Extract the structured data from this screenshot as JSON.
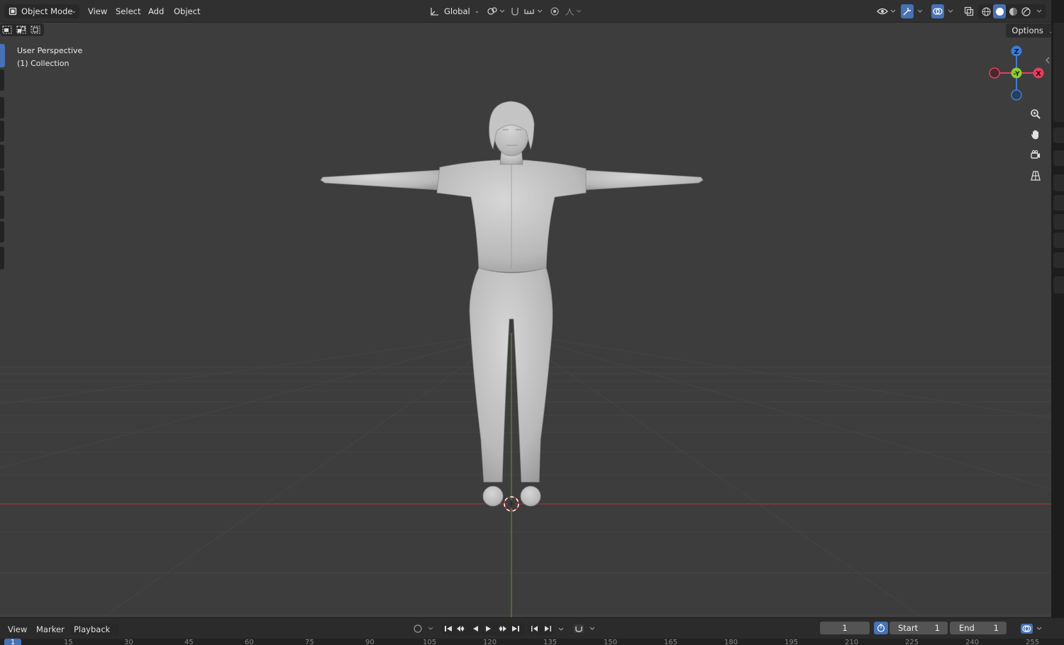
{
  "header": {
    "mode_label": "Object Mode",
    "menus": [
      "View",
      "Select",
      "Add",
      "Object"
    ],
    "orientation_label": "Global",
    "options_label": "Options"
  },
  "overlay": {
    "line1": "User Perspective",
    "line2": "(1) Collection"
  },
  "gizmo": {
    "z_label": "Z",
    "y_label": "-Y",
    "x_label": "X"
  },
  "timeline": {
    "menus": [
      "View",
      "Marker"
    ],
    "playback_label": "Playback",
    "current_frame": "1",
    "start_label": "Start",
    "start_value": "1",
    "end_label": "End",
    "end_value": "1",
    "ruler_marker": "1",
    "ruler_ticks": [
      "15",
      "30",
      "45",
      "60",
      "75",
      "90",
      "105",
      "120",
      "135",
      "150",
      "165",
      "180",
      "195",
      "210",
      "225",
      "240",
      "255"
    ]
  },
  "colors": {
    "viewport_bg": "#3d3d3d",
    "header_bg": "#303030",
    "accent_blue": "#4772b3",
    "axis_x_red": "#e0415e",
    "axis_y_green": "#8fcc33",
    "axis_z_blue": "#3b7dd8"
  }
}
